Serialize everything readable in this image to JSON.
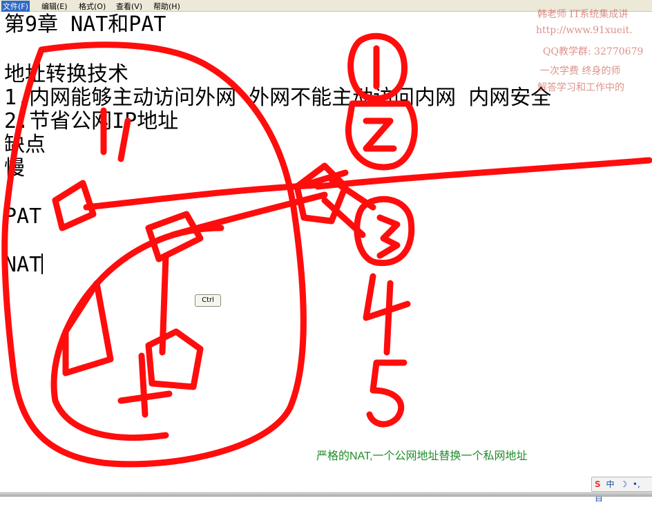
{
  "menu": {
    "file": "文件(F)",
    "edit": "编辑(E)",
    "format": "格式(O)",
    "view": "查看(V)",
    "help": "帮助(H)"
  },
  "document": {
    "lines": [
      "第9章 NAT和PAT",
      "",
      "地址转换技术",
      "1.内网能够主动访问外网 外网不能主动访问内网 内网安全",
      "2.节省公网IP地址",
      "缺点",
      "慢",
      "",
      "PAT",
      "",
      "NAT"
    ]
  },
  "watermark": {
    "line1": "韩老师 IT系统集成讲",
    "line2": "http://www.91xueit.",
    "line3": "QQ教学群: 32770679",
    "line4": "一次学费  终身的师",
    "line5": "解答学习和工作中的"
  },
  "tooltip": {
    "label": "Ctrl"
  },
  "caption": "严格的NAT,一个公网地址替换一个私网地址",
  "ime": {
    "logo": "S",
    "lang": "中",
    "moon": "☽",
    "dot": "•,",
    "extra": "目"
  },
  "colors": {
    "ink": "#ff0d0d",
    "caption": "#1e8c28",
    "watermark": "#c0392b"
  }
}
